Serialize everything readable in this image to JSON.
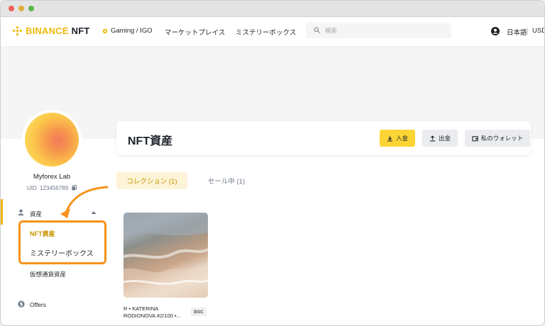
{
  "header": {
    "logo_brand": "BINANCE",
    "logo_product": "NFT",
    "nav": {
      "gaming": "Gaming / IGO",
      "marketplace": "マーケットプレイス",
      "mystery": "ミステリーボックス"
    },
    "search_placeholder": "検索",
    "language": "日本語",
    "divider": "|",
    "currency": "USD"
  },
  "profile": {
    "username": "Myforex Lab",
    "uid_label": "UID",
    "uid_value": "123456789"
  },
  "sidebar": {
    "assets": "資産",
    "nft_assets": "NFT資産",
    "mystery_box": "ミステリーボックス",
    "crypto_assets": "仮想通貨資産",
    "offers": "Offers"
  },
  "main": {
    "title": "NFT資産",
    "buttons": {
      "deposit": "入金",
      "withdraw": "出金",
      "wallet": "私のウォレット"
    },
    "tabs": {
      "collection": "コレクション (1)",
      "on_sale": "セール中 (1)"
    },
    "nft": {
      "name_line1": "R • KATERINA",
      "name_line2": "RODIONOVA #2/100 •...",
      "chain": "BSC"
    }
  },
  "colors": {
    "brand": "#f0b90b",
    "annotation": "#f7931a",
    "active_tab_bg": "#fdf3d6",
    "active_tab_text": "#c99400"
  }
}
